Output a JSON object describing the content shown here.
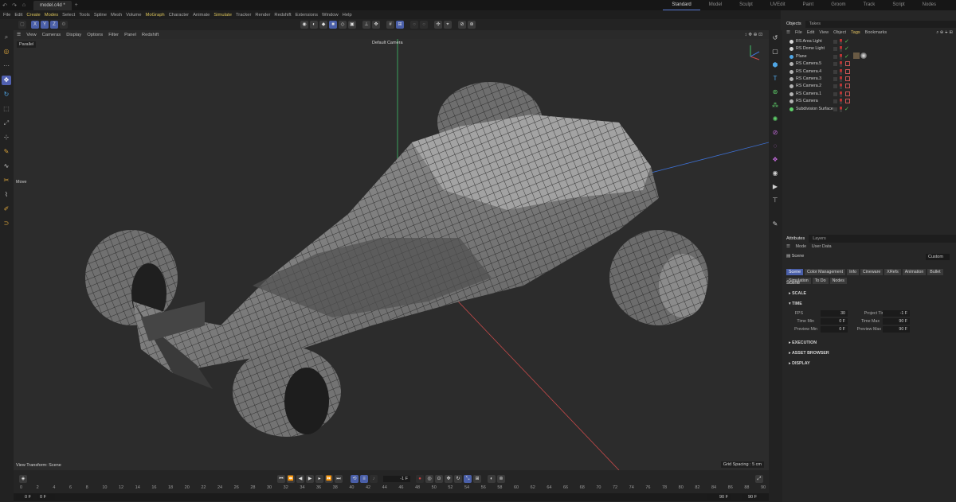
{
  "title_bar": {
    "tab": "model.c4d *",
    "layouts": [
      "Standard",
      "Model",
      "Sculpt",
      "UVEdit",
      "Paint",
      "Groom",
      "Track",
      "Script",
      "Nodes"
    ],
    "active_layout": "Standard"
  },
  "menu": [
    "File",
    "Edit",
    "Create",
    "Modes",
    "Select",
    "Tools",
    "Spline",
    "Mesh",
    "Volume",
    "MoGraph",
    "Character",
    "Animate",
    "Simulate",
    "Tracker",
    "Render",
    "Redshift",
    "Extensions",
    "Window",
    "Help"
  ],
  "highlighted_menus": [
    "Create",
    "Modes",
    "MoGraph",
    "Simulate"
  ],
  "axis_buttons": [
    "X",
    "Y",
    "Z"
  ],
  "viewport": {
    "menu": [
      "View",
      "Cameras",
      "Display",
      "Options",
      "Filter",
      "Panel",
      "Redshift"
    ],
    "projection": "Parallel",
    "camera": "Default Camera",
    "tool_hint": "Move",
    "view_transform": "View Transform: Scene",
    "grid_spacing": "Grid Spacing : 5 cm"
  },
  "timeline": {
    "current_frame": "-1 F",
    "ticks": [
      "0",
      "2",
      "4",
      "6",
      "8",
      "10",
      "12",
      "14",
      "16",
      "18",
      "20",
      "22",
      "24",
      "26",
      "28",
      "30",
      "32",
      "34",
      "36",
      "38",
      "40",
      "42",
      "44",
      "46",
      "48",
      "50",
      "52",
      "54",
      "56",
      "58",
      "60",
      "62",
      "64",
      "66",
      "68",
      "70",
      "72",
      "74",
      "76",
      "78",
      "80",
      "82",
      "84",
      "86",
      "88",
      "90"
    ],
    "range_start": "0 F",
    "range_start2": "0 F",
    "range_end": "90 F",
    "range_end2": "90 F"
  },
  "objects_panel": {
    "tabs": [
      "Objects",
      "Takes"
    ],
    "active_tab": "Objects",
    "menu": [
      "File",
      "Edit",
      "View",
      "Object",
      "Tags",
      "Bookmarks"
    ],
    "highlighted_menu": "Tags",
    "items": [
      "RS Area Light",
      "RS Dome Light",
      "Plane",
      "RS Camera.5",
      "RS Camera.4",
      "RS Camera.3",
      "RS Camera.2",
      "RS Camera.1",
      "RS Camera",
      "Subdivision Surface"
    ]
  },
  "attributes_panel": {
    "tabs": [
      "Attributes",
      "Layers"
    ],
    "active_tab": "Attributes",
    "mode_items": [
      "Mode",
      "User Data"
    ],
    "object": "Scene",
    "preset": "Custom",
    "tabs_row1": [
      "Scene",
      "Color Management",
      "Info",
      "Cineware",
      "XRefs",
      "Animation",
      "Bullet"
    ],
    "tabs_row2": [
      "Simulation",
      "To Do",
      "Nodes"
    ],
    "heading": "Scene",
    "sections": [
      "SCALE",
      "TIME",
      "EXECUTION",
      "ASSET BROWSER",
      "DISPLAY"
    ],
    "time": {
      "fps_label": "FPS",
      "fps": "30",
      "project_time_label": "Project Time",
      "project_time": "-1 F",
      "time_min_label": "Time Min",
      "time_min": "0 F",
      "time_max_label": "Time Max",
      "time_max": "90 F",
      "preview_min_label": "Preview Min",
      "preview_min": "0 F",
      "preview_max_label": "Preview Max",
      "preview_max": "90 F"
    }
  },
  "colors": {
    "accent": "#4a5fa8",
    "highlight_menu": "#d9c25a",
    "y_axis": "#3fbf6a",
    "x_axis": "#c84a4a",
    "z_axis": "#3d6fd0"
  }
}
